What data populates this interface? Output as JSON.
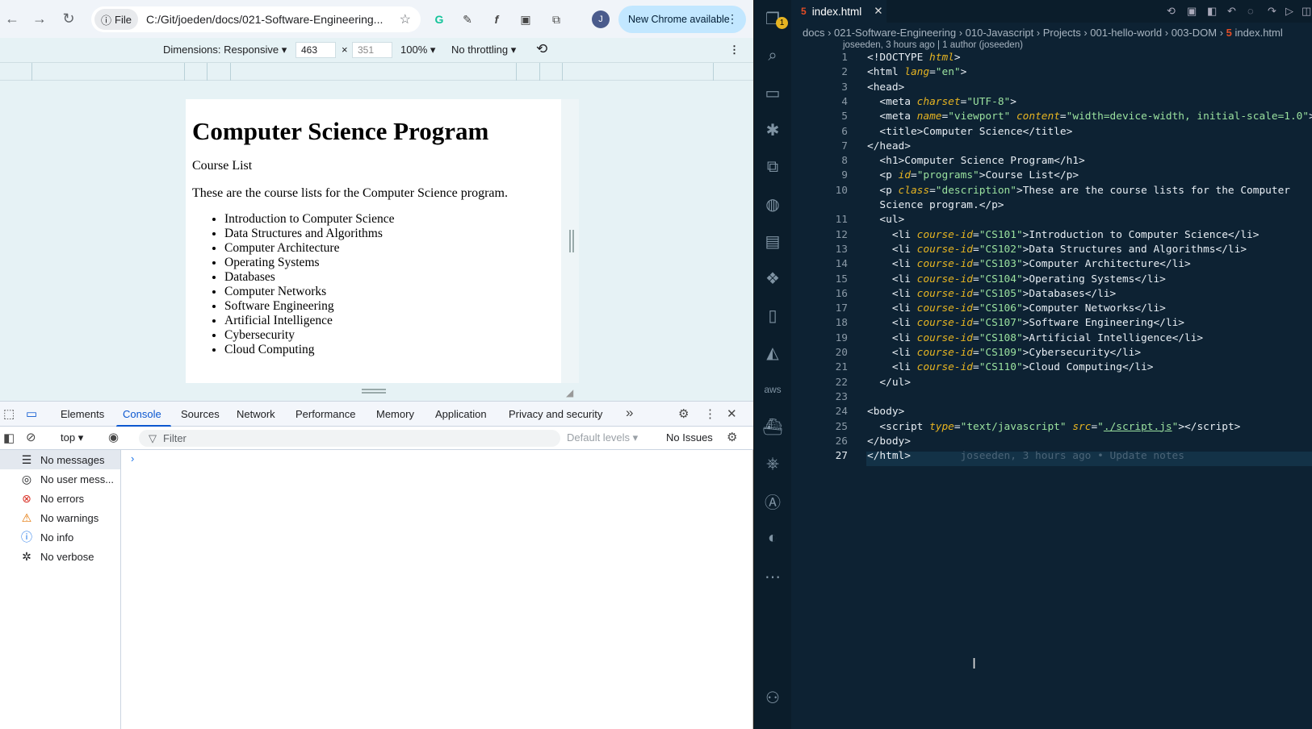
{
  "browser": {
    "file_chip": "File",
    "url": "C:/Git/joeden/docs/021-Software-Engineering...",
    "avatar_letter": "J",
    "new_chrome": "New Chrome available"
  },
  "device_toolbar": {
    "dimensions_label": "Dimensions: Responsive",
    "width": "463",
    "height": "351",
    "times": "×",
    "zoom": "100%",
    "throttling": "No throttling"
  },
  "rendered_page": {
    "title": "Computer Science Program",
    "subtitle": "Course List",
    "description": "These are the course lists for the Computer Science program.",
    "courses": [
      "Introduction to Computer Science",
      "Data Structures and Algorithms",
      "Computer Architecture",
      "Operating Systems",
      "Databases",
      "Computer Networks",
      "Software Engineering",
      "Artificial Intelligence",
      "Cybersecurity",
      "Cloud Computing"
    ]
  },
  "devtools": {
    "tabs": [
      "Elements",
      "Console",
      "Sources",
      "Network",
      "Performance",
      "Memory",
      "Application",
      "Privacy and security"
    ],
    "active_tab": "Console",
    "context": "top",
    "filter_placeholder": "Filter",
    "levels": "Default levels",
    "issues": "No Issues",
    "sidebar": [
      "No messages",
      "No user mess...",
      "No errors",
      "No warnings",
      "No info",
      "No verbose"
    ],
    "prompt": "›"
  },
  "vscode": {
    "tab_name": "index.html",
    "badge": "1",
    "breadcrumb": [
      "docs",
      "021-Software-Engineering",
      "010-Javascript",
      "Projects",
      "001-hello-world",
      "003-DOM",
      "index.html"
    ],
    "blame": "joseeden, 3 hours ago | 1 author (joseeden)",
    "ghost_blame": "joseeden, 3 hours ago • Update notes",
    "line_numbers": [
      "1",
      "2",
      "3",
      "4",
      "5",
      "6",
      "7",
      "8",
      "9",
      "10",
      "",
      "11",
      "12",
      "13",
      "14",
      "15",
      "16",
      "17",
      "18",
      "19",
      "20",
      "21",
      "22",
      "23",
      "24",
      "25",
      "26",
      "27"
    ],
    "current_line": "27"
  },
  "colors": {
    "accent": "#0b57d0",
    "editor_bg": "#0d2233",
    "attr": "#e6b422",
    "string": "#9be29f"
  }
}
